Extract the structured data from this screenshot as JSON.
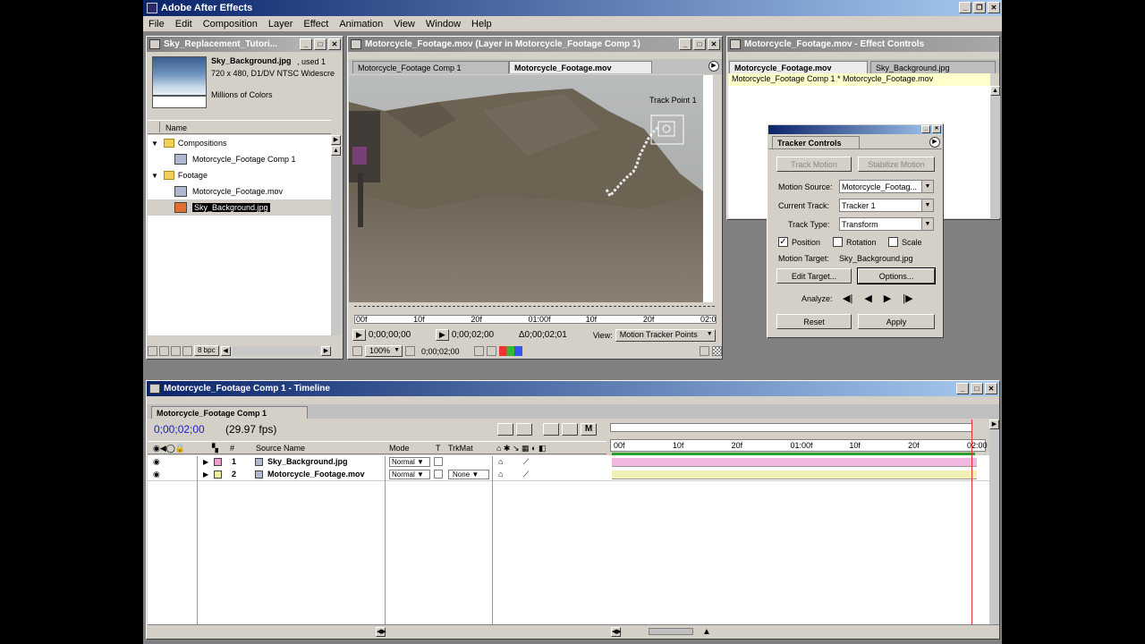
{
  "app": {
    "title": "Adobe After Effects"
  },
  "menu": [
    "File",
    "Edit",
    "Composition",
    "Layer",
    "Effect",
    "Animation",
    "View",
    "Window",
    "Help"
  ],
  "project": {
    "title": "Sky_Replacement_Tutori...",
    "thumb_name": "Sky_Background.jpg",
    "thumb_used": ", used 1",
    "thumb_dims": "720 x 480, D1/DV NTSC Widescre",
    "thumb_colors": "Millions of Colors",
    "col_name": "Name",
    "items": [
      {
        "type": "folder",
        "label": "Compositions"
      },
      {
        "type": "comp",
        "label": "Motorcycle_Footage Comp 1"
      },
      {
        "type": "folder",
        "label": "Footage"
      },
      {
        "type": "footage",
        "label": "Motorcycle_Footage.mov"
      },
      {
        "type": "image",
        "label": "Sky_Background.jpg"
      }
    ],
    "bpc": "8 bpc"
  },
  "layer_window": {
    "title": "Motorcycle_Footage.mov (Layer in Motorcycle_Footage Comp 1)",
    "tab1": "Motorcycle_Footage Comp 1",
    "tab2": "Motorcycle_Footage.mov",
    "track_point": "Track Point 1",
    "ruler": [
      "00f",
      "10f",
      "20f",
      "01:00f",
      "10f",
      "20f",
      "02:0"
    ],
    "in_time": "0;00;00;00",
    "out_time": "0;00;02;00",
    "duration": "Δ0;00;02;01",
    "view_label": "View:",
    "view_value": "Motion Tracker Points",
    "zoom": "100%",
    "current_time": "0;00;02;00"
  },
  "effect_controls": {
    "title": "Motorcycle_Footage.mov - Effect Controls",
    "tab1": "Motorcycle_Footage.mov",
    "tab2": "Sky_Background.jpg",
    "breadcrumb": "Motorcycle_Footage Comp 1 * Motorcycle_Footage.mov"
  },
  "tracker": {
    "title": "Tracker Controls",
    "track_motion": "Track Motion",
    "stabilize_motion": "Stabilize Motion",
    "motion_source_label": "Motion Source:",
    "motion_source": "Motorcycle_Footag...",
    "current_track_label": "Current Track:",
    "current_track": "Tracker 1",
    "track_type_label": "Track Type:",
    "track_type": "Transform",
    "position": "Position",
    "rotation": "Rotation",
    "scale": "Scale",
    "motion_target_label": "Motion Target:",
    "motion_target": "Sky_Background.jpg",
    "edit_target": "Edit Target...",
    "options": "Options...",
    "analyze": "Analyze:",
    "reset": "Reset",
    "apply": "Apply"
  },
  "timeline": {
    "title": "Motorcycle_Footage Comp 1 - Timeline",
    "tab": "Motorcycle_Footage Comp 1",
    "time": "0;00;02;00",
    "fps": "(29.97 fps)",
    "cols": {
      "num": "#",
      "source": "Source Name",
      "mode": "Mode",
      "t": "T",
      "trkmat": "TrkMat"
    },
    "ruler": [
      "00f",
      "10f",
      "20f",
      "01:00f",
      "10f",
      "20f",
      "02:00"
    ],
    "layers": [
      {
        "num": "1",
        "name": "Sky_Background.jpg",
        "mode": "Normal",
        "trkmat": "",
        "color": "#e9a0c8",
        "bar": "#f0b8e0"
      },
      {
        "num": "2",
        "name": "Motorcycle_Footage.mov",
        "mode": "Normal",
        "trkmat": "None",
        "color": "#f0ec9c",
        "bar": "#f2f0b4"
      }
    ],
    "work_area_color": "#2ca02c"
  }
}
